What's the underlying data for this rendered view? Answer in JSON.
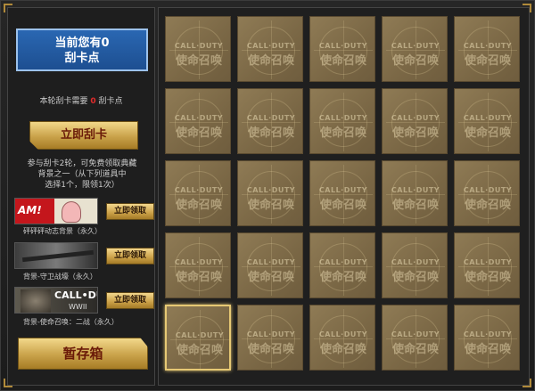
{
  "sidebar": {
    "points_line1": "当前您有0",
    "points_line2": "刮卡点",
    "need_prefix": "本轮刮卡需要",
    "need_value": "0",
    "need_suffix": "刮卡点",
    "scratch_button": "立即刮卡",
    "desc_line1": "参与刮卡2轮，可免费领取典藏",
    "desc_line2": "背景之一（从下列道具中",
    "desc_line3": "选择1个，限领1次）",
    "rewards": [
      {
        "thumb_text": "AM!",
        "claim": "立即领取",
        "label": "砰砰砰动志背景（永久）"
      },
      {
        "thumb_text": "",
        "claim": "立即领取",
        "label": "背景-守卫战壕（永久）"
      },
      {
        "thumb_text": "CALL•DU",
        "thumb_sub": "WWII",
        "claim": "立即领取",
        "label": "背景-使命召唤：二战（永久）"
      }
    ],
    "stash_button": "暂存箱"
  },
  "grid": {
    "card_logo_en": "CALL·DUTY",
    "card_logo_cn": "使命召唤",
    "selected_index": 20
  }
}
